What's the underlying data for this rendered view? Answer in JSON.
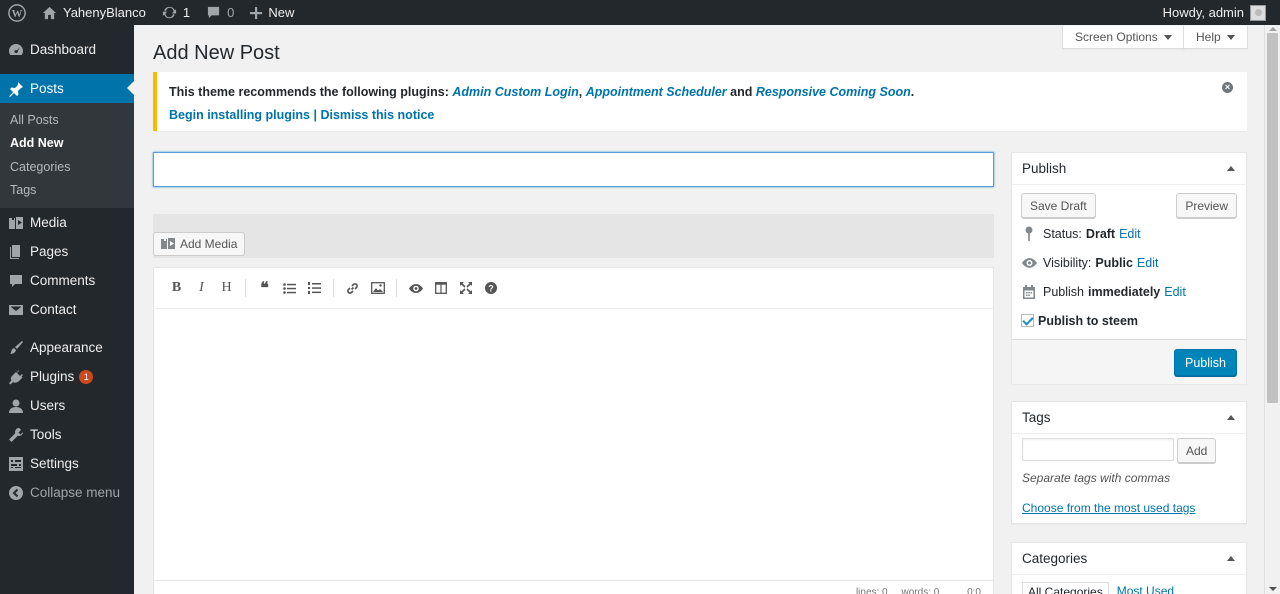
{
  "adminbar": {
    "site_name": "YahenyBlanco",
    "updates_count": "1",
    "comments_count": "0",
    "new_label": "New",
    "howdy": "Howdy, admin"
  },
  "sidebar": {
    "dashboard": "Dashboard",
    "posts": "Posts",
    "posts_sub": [
      "All Posts",
      "Add New",
      "Categories",
      "Tags"
    ],
    "media": "Media",
    "pages": "Pages",
    "comments": "Comments",
    "contact": "Contact",
    "appearance": "Appearance",
    "plugins": "Plugins",
    "plugins_badge": "1",
    "users": "Users",
    "tools": "Tools",
    "settings": "Settings",
    "collapse": "Collapse menu"
  },
  "header": {
    "title": "Add New Post",
    "screen_options": "Screen Options",
    "help": "Help"
  },
  "notice": {
    "text": "This theme recommends the following plugins: ",
    "plugin1": "Admin Custom Login",
    "comma": ", ",
    "plugin2": "Appointment Scheduler",
    "and": " and ",
    "plugin3": "Responsive Coming Soon",
    "period": ".",
    "begin": "Begin installing plugins",
    "sep": " | ",
    "dismiss": "Dismiss this notice"
  },
  "editor": {
    "title_value": "",
    "add_media": "Add Media",
    "status_text": "lines: 0     words: 0          0:0"
  },
  "publish_box": {
    "title": "Publish",
    "save_draft": "Save Draft",
    "preview": "Preview",
    "status_label": "Status:",
    "status_value": "Draft",
    "visibility_label": "Visibility:",
    "visibility_value": "Public",
    "publish_label": "Publish",
    "publish_value": "immediately",
    "edit": "Edit",
    "steem_label": "Publish to steem",
    "publish_button": "Publish"
  },
  "tags_box": {
    "title": "Tags",
    "add": "Add",
    "hint": "Separate tags with commas",
    "choose": "Choose from the most used tags"
  },
  "categories_box": {
    "title": "Categories",
    "tab_all": "All Categories",
    "tab_most": "Most Used"
  }
}
